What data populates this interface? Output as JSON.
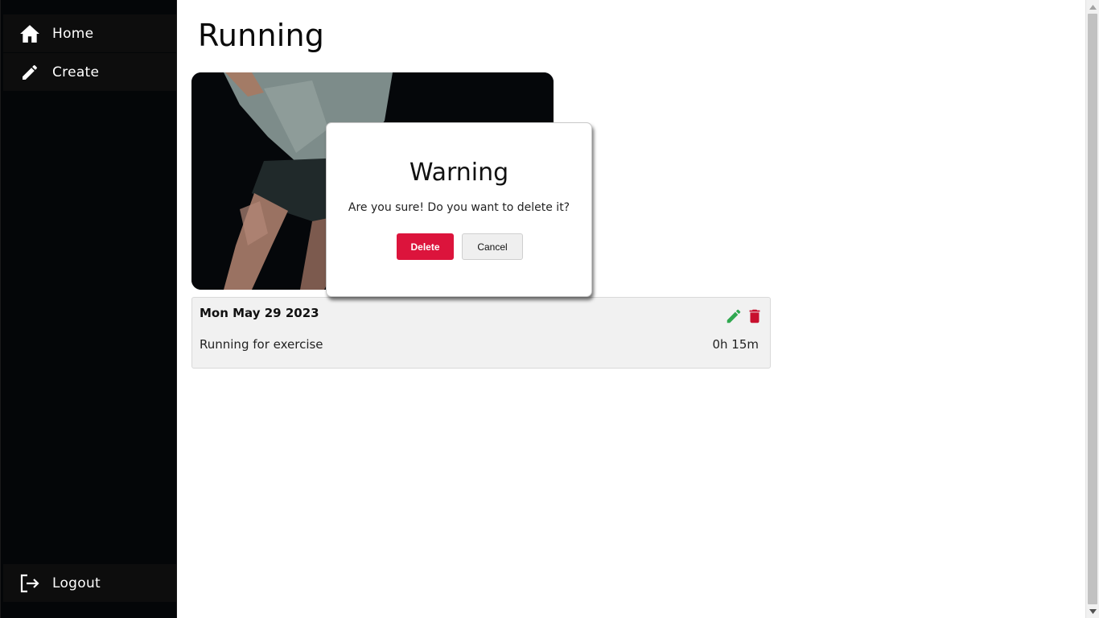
{
  "sidebar": {
    "items": [
      {
        "label": "Home",
        "icon": "home-icon"
      },
      {
        "label": "Create",
        "icon": "pencil-icon"
      }
    ],
    "logout": {
      "label": "Logout",
      "icon": "logout-icon"
    }
  },
  "main": {
    "title": "Running",
    "card": {
      "date": "Mon May 29 2023",
      "description": "Running for exercise",
      "duration": "0h 15m"
    }
  },
  "modal": {
    "title": "Warning",
    "message": "Are you sure! Do you want to delete it?",
    "delete_label": "Delete",
    "cancel_label": "Cancel"
  },
  "colors": {
    "sidebar_bg": "#040608",
    "delete_red": "#dc143c",
    "edit_green": "#2fa84f"
  }
}
